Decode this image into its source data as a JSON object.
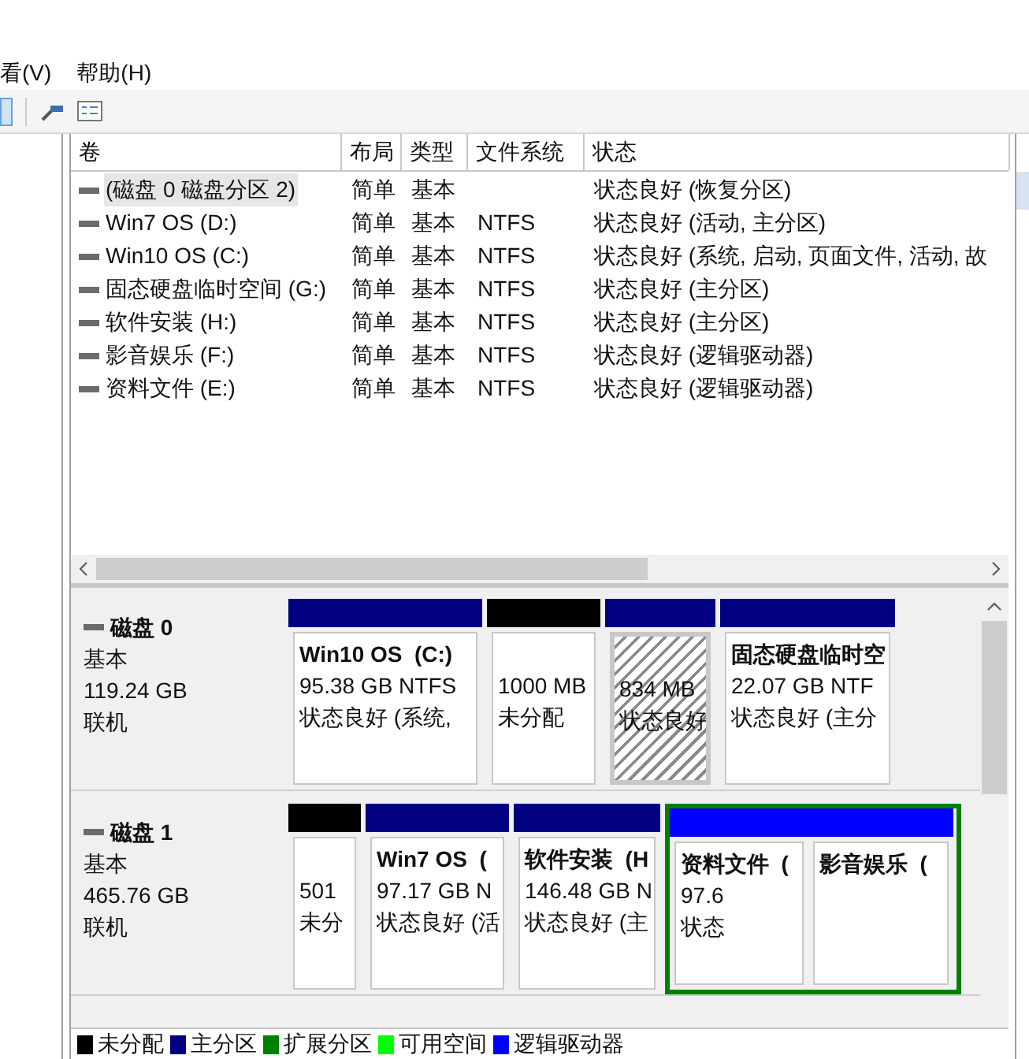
{
  "menu": [
    "看(V)",
    "帮助(H)"
  ],
  "volumes": {
    "columns": [
      "卷",
      "布局",
      "类型",
      "文件系统",
      "状态"
    ],
    "rows": [
      {
        "cells": [
          "(磁盘 0 磁盘分区 2)",
          "简单",
          "基本",
          "",
          "状态良好 (恢复分区)"
        ],
        "selected": true
      },
      {
        "cells": [
          "Win7 OS (D:)",
          "简单",
          "基本",
          "NTFS",
          "状态良好 (活动, 主分区)"
        ],
        "selected": false
      },
      {
        "cells": [
          "Win10 OS (C:)",
          "简单",
          "基本",
          "NTFS",
          "状态良好 (系统, 启动, 页面文件, 活动, 故"
        ],
        "selected": false
      },
      {
        "cells": [
          "固态硬盘临时空间 (G:)",
          "简单",
          "基本",
          "NTFS",
          "状态良好 (主分区)"
        ],
        "selected": false
      },
      {
        "cells": [
          "软件安装 (H:)",
          "简单",
          "基本",
          "NTFS",
          "状态良好 (主分区)"
        ],
        "selected": false
      },
      {
        "cells": [
          "影音娱乐 (F:)",
          "简单",
          "基本",
          "NTFS",
          "状态良好 (逻辑驱动器)"
        ],
        "selected": false
      },
      {
        "cells": [
          "资料文件 (E:)",
          "简单",
          "基本",
          "NTFS",
          "状态良好 (逻辑驱动器)"
        ],
        "selected": false
      }
    ]
  },
  "disks": [
    {
      "name": "磁盘 0",
      "type": "基本",
      "size": "119.24 GB",
      "status": "联机",
      "partitions": [
        {
          "kind": "primary",
          "title": "Win10 OS  (C:)",
          "lines": [
            "95.38 GB NTFS",
            "状态良好 (系统,"
          ],
          "selected": false
        },
        {
          "kind": "unallocated",
          "lines": [
            "1000 MB",
            "未分配"
          ],
          "selected": false
        },
        {
          "kind": "primary",
          "lines": [
            "834 MB",
            "状态良好"
          ],
          "selected": true
        },
        {
          "kind": "primary",
          "title": "固态硬盘临时空",
          "lines": [
            "22.07 GB NTF",
            "状态良好 (主分"
          ],
          "selected": false
        }
      ]
    },
    {
      "name": "磁盘 1",
      "type": "基本",
      "size": "465.76 GB",
      "status": "联机",
      "partitions": [
        {
          "kind": "unallocated",
          "lines": [
            "501",
            "未分"
          ],
          "selected": false
        },
        {
          "kind": "primary",
          "title": "Win7 OS  (",
          "lines": [
            "97.17 GB N",
            "状态良好 (活"
          ],
          "selected": false
        },
        {
          "kind": "primary",
          "title": "软件安装  (H",
          "lines": [
            "146.48 GB N",
            "状态良好 (主"
          ],
          "selected": false
        },
        {
          "kind": "extended",
          "children": [
            {
              "kind": "logical",
              "title": "资料文件  (",
              "lines": [
                "97.6",
                "状态"
              ],
              "selected": false
            },
            {
              "kind": "logical",
              "title": "影音娱乐  (",
              "selected": false
            }
          ]
        }
      ]
    }
  ],
  "legend": [
    {
      "label": "未分配",
      "color": "#000000"
    },
    {
      "label": "主分区",
      "color": "#000080"
    },
    {
      "label": "扩展分区",
      "color": "#008000"
    },
    {
      "label": "可用空间",
      "color": "#00ff00"
    },
    {
      "label": "逻辑驱动器",
      "color": "#0000ff"
    }
  ]
}
